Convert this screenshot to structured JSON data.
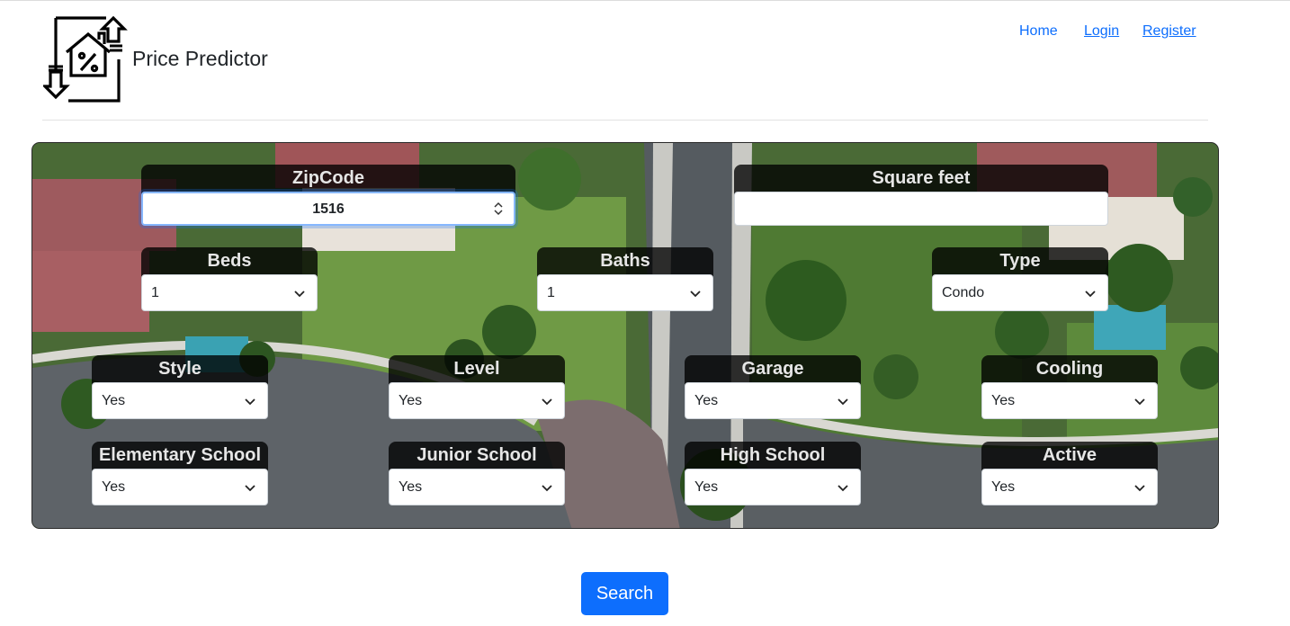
{
  "header": {
    "brand": "Price Predictor",
    "logo_icon": "house-percent-icon",
    "nav": {
      "home": "Home",
      "login": "Login",
      "register": "Register"
    }
  },
  "form": {
    "zipcode": {
      "label": "ZipCode",
      "value": "1516"
    },
    "square_feet": {
      "label": "Square feet",
      "value": ""
    },
    "beds": {
      "label": "Beds",
      "value": "1"
    },
    "baths": {
      "label": "Baths",
      "value": "1"
    },
    "type": {
      "label": "Type",
      "value": "Condo"
    },
    "style": {
      "label": "Style",
      "value": "Yes"
    },
    "level": {
      "label": "Level",
      "value": "Yes"
    },
    "garage": {
      "label": "Garage",
      "value": "Yes"
    },
    "cooling": {
      "label": "Cooling",
      "value": "Yes"
    },
    "elementary_school": {
      "label": "Elementary School",
      "value": "Yes"
    },
    "junior_school": {
      "label": "Junior School",
      "value": "Yes"
    },
    "high_school": {
      "label": "High School",
      "value": "Yes"
    },
    "active": {
      "label": "Active",
      "value": "Yes"
    }
  },
  "search_button": "Search",
  "colors": {
    "accent": "#0d6efd",
    "label_bg": "#000000"
  }
}
